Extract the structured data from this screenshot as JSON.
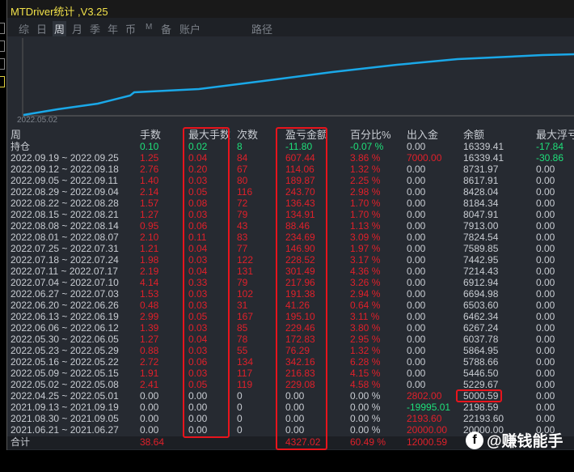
{
  "title": "MTDriver统计 ,V3.25",
  "tabs": [
    "综",
    "日",
    "周",
    "月",
    "季",
    "年",
    "币",
    "M",
    "备",
    "账户",
    "路径"
  ],
  "active_tab": "周",
  "chart": {
    "start_label": "2022.05.02",
    "line_color": "#1aa8e8"
  },
  "headers": [
    "周",
    "手数",
    "最大手数",
    "次数",
    "盈亏金额",
    "百分比%",
    "出入金",
    "余额",
    "最大浮亏"
  ],
  "position_row": {
    "label": "持仓",
    "lots": "0.10",
    "max_lots": "0.02",
    "count": "8",
    "pnl": "-11.80",
    "pct": "-0.07 %",
    "flow": "0.00",
    "balance": "16339.41",
    "max_float": "-17.84"
  },
  "rows": [
    [
      "2022.09.19 ~ 2022.09.25",
      "1.25",
      "0.04",
      "84",
      "607.44",
      "3.86 %",
      "7000.00",
      "16339.41",
      "-30.86"
    ],
    [
      "2022.09.12 ~ 2022.09.18",
      "2.76",
      "0.20",
      "67",
      "114.06",
      "1.32 %",
      "0.00",
      "8731.97",
      "0.00"
    ],
    [
      "2022.09.05 ~ 2022.09.11",
      "1.40",
      "0.03",
      "80",
      "189.87",
      "2.25 %",
      "0.00",
      "8617.91",
      "0.00"
    ],
    [
      "2022.08.29 ~ 2022.09.04",
      "2.14",
      "0.05",
      "116",
      "243.70",
      "2.98 %",
      "0.00",
      "8428.04",
      "0.00"
    ],
    [
      "2022.08.22 ~ 2022.08.28",
      "1.57",
      "0.08",
      "72",
      "136.43",
      "1.70 %",
      "0.00",
      "8184.34",
      "0.00"
    ],
    [
      "2022.08.15 ~ 2022.08.21",
      "1.27",
      "0.03",
      "79",
      "134.91",
      "1.70 %",
      "0.00",
      "8047.91",
      "0.00"
    ],
    [
      "2022.08.08 ~ 2022.08.14",
      "0.95",
      "0.06",
      "43",
      "88.46",
      "1.13 %",
      "0.00",
      "7913.00",
      "0.00"
    ],
    [
      "2022.08.01 ~ 2022.08.07",
      "2.10",
      "0.11",
      "83",
      "234.69",
      "3.09 %",
      "0.00",
      "7824.54",
      "0.00"
    ],
    [
      "2022.07.25 ~ 2022.07.31",
      "1.21",
      "0.04",
      "77",
      "146.90",
      "1.97 %",
      "0.00",
      "7589.85",
      "0.00"
    ],
    [
      "2022.07.18 ~ 2022.07.24",
      "1.98",
      "0.03",
      "122",
      "228.52",
      "3.17 %",
      "0.00",
      "7442.95",
      "0.00"
    ],
    [
      "2022.07.11 ~ 2022.07.17",
      "2.19",
      "0.04",
      "131",
      "301.49",
      "4.36 %",
      "0.00",
      "7214.43",
      "0.00"
    ],
    [
      "2022.07.04 ~ 2022.07.10",
      "4.14",
      "0.33",
      "79",
      "217.96",
      "3.26 %",
      "0.00",
      "6912.94",
      "0.00"
    ],
    [
      "2022.06.27 ~ 2022.07.03",
      "1.53",
      "0.03",
      "102",
      "191.38",
      "2.94 %",
      "0.00",
      "6694.98",
      "0.00"
    ],
    [
      "2022.06.20 ~ 2022.06.26",
      "0.48",
      "0.03",
      "31",
      "41.26",
      "0.64 %",
      "0.00",
      "6503.60",
      "0.00"
    ],
    [
      "2022.06.13 ~ 2022.06.19",
      "2.99",
      "0.05",
      "167",
      "195.10",
      "3.11 %",
      "0.00",
      "6462.34",
      "0.00"
    ],
    [
      "2022.06.06 ~ 2022.06.12",
      "1.39",
      "0.03",
      "85",
      "229.46",
      "3.80 %",
      "0.00",
      "6267.24",
      "0.00"
    ],
    [
      "2022.05.30 ~ 2022.06.05",
      "1.27",
      "0.04",
      "78",
      "172.83",
      "2.95 %",
      "0.00",
      "6037.78",
      "0.00"
    ],
    [
      "2022.05.23 ~ 2022.05.29",
      "0.88",
      "0.03",
      "55",
      "76.29",
      "1.32 %",
      "0.00",
      "5864.95",
      "0.00"
    ],
    [
      "2022.05.16 ~ 2022.05.22",
      "2.72",
      "0.06",
      "134",
      "342.16",
      "6.28 %",
      "0.00",
      "5788.66",
      "0.00"
    ],
    [
      "2022.05.09 ~ 2022.05.15",
      "1.91",
      "0.03",
      "117",
      "216.83",
      "4.15 %",
      "0.00",
      "5446.50",
      "0.00"
    ],
    [
      "2022.05.02 ~ 2022.05.08",
      "2.41",
      "0.05",
      "119",
      "229.08",
      "4.58 %",
      "0.00",
      "5229.67",
      "0.00"
    ],
    [
      "2022.04.25 ~ 2022.05.01",
      "0.00",
      "0.00",
      "0",
      "0.00",
      "0.00 %",
      "2802.00",
      "5000.59",
      "0.00"
    ],
    [
      "2021.09.13 ~ 2021.09.19",
      "0.00",
      "0.00",
      "0",
      "0.00",
      "0.00 %",
      "-19995.01",
      "2198.59",
      "0.00"
    ],
    [
      "2021.08.30 ~ 2021.09.05",
      "0.00",
      "0.00",
      "0",
      "0.00",
      "0.00 %",
      "2193.60",
      "22193.60",
      "0.00"
    ],
    [
      "2021.06.21 ~ 2021.06.27",
      "0.00",
      "0.00",
      "0",
      "0.00",
      "0.00 %",
      "20000.00",
      "20000.00",
      "0.00"
    ]
  ],
  "total_row": {
    "label": "合计",
    "lots": "38.64",
    "pnl": "4327.02",
    "pct": "60.49 %",
    "flow": "12000.59"
  },
  "watermark": "@赚钱能手",
  "colors": {
    "red": "#e0202a",
    "green": "#1ee07a",
    "highlight": "#e8141c"
  }
}
